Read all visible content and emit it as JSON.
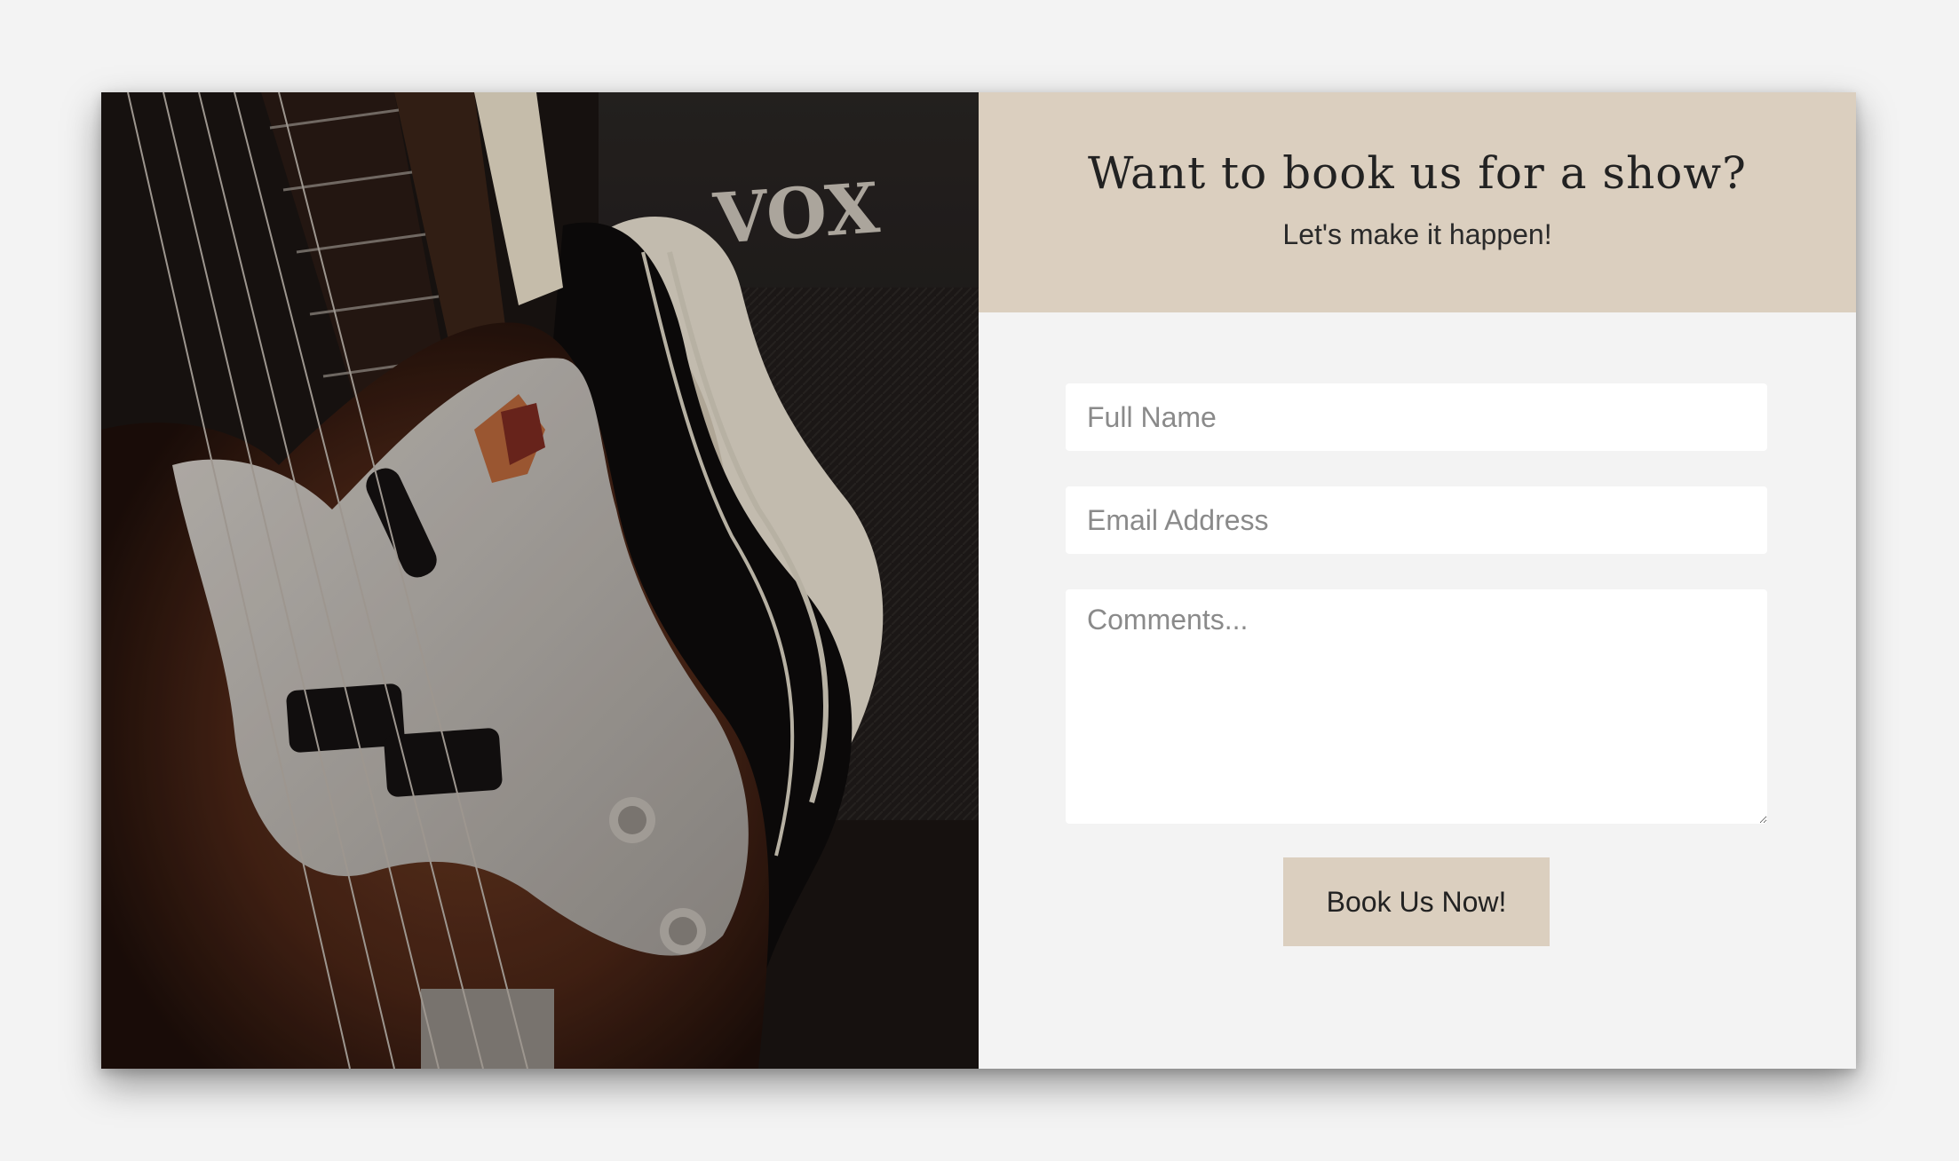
{
  "header": {
    "title": "Want to book us for a show?",
    "subtitle": "Let's make it happen!"
  },
  "form": {
    "name_placeholder": "Full Name",
    "email_placeholder": "Email Address",
    "comments_placeholder": "Comments...",
    "submit_label": "Book Us Now!"
  },
  "photo": {
    "amp_brand": "VOX"
  },
  "colors": {
    "accent": "#dbcfbf",
    "background": "#f3f3f3"
  }
}
